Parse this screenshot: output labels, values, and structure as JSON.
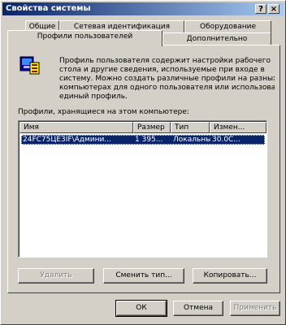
{
  "window": {
    "title": "Свойства системы",
    "help_button": "?",
    "close_button": "×"
  },
  "tabs": {
    "row1": [
      "Общие",
      "Сетевая идентификация",
      "Оборудование"
    ],
    "row2": [
      "Профили пользователей",
      "Дополнительно"
    ],
    "active": "Профили пользователей"
  },
  "description": [
    "Профиль пользователя содержит настройки рабочего",
    "стола и другие сведения, используемые при входе в",
    "систему. Можно создать различные профили на разных",
    "компьютерах для одного пользователя или использовать",
    "единый профиль."
  ],
  "profiles_label": "Профили, хранящиеся на этом компьютере:",
  "profiles_table": {
    "columns": [
      "Имя",
      "Размер",
      "Тип",
      "Измен..."
    ],
    "rows": [
      {
        "name": "24FC75ЦЕ3IF\\Админи...",
        "size": "1 395...",
        "type": "Локальный",
        "modified": "30.0С..."
      }
    ]
  },
  "profile_buttons": {
    "delete": "Удалить",
    "change_type": "Сменить тип...",
    "copy": "Копировать..."
  },
  "dialog_buttons": {
    "ok": "ОК",
    "cancel": "Отмена",
    "apply": "Применить"
  },
  "colors": {
    "face": "#d4d0c8",
    "titlebar_start": "#0a246a",
    "titlebar_end": "#a6caf0",
    "selection": "#0a246a"
  },
  "icons": [
    "help-icon",
    "close-icon",
    "user-profile-icon"
  ]
}
